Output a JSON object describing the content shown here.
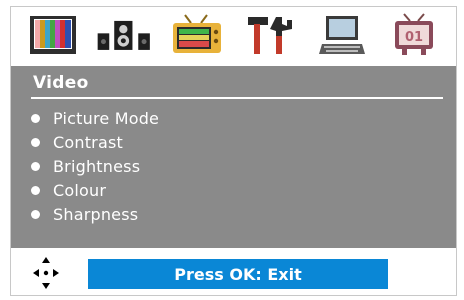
{
  "icons": [
    {
      "name": "picture-icon"
    },
    {
      "name": "audio-speakers-icon"
    },
    {
      "name": "tv-icon"
    },
    {
      "name": "tools-icon"
    },
    {
      "name": "computer-icon"
    },
    {
      "name": "channel-tv-icon",
      "text": "01"
    }
  ],
  "menu": {
    "title": "Video",
    "items": [
      {
        "label": "Picture Mode"
      },
      {
        "label": "Contrast"
      },
      {
        "label": "Brightness"
      },
      {
        "label": "Colour"
      },
      {
        "label": "Sharpness"
      }
    ]
  },
  "footer": {
    "nav_icon": "directional-pad-icon",
    "exit_label": "Press OK: Exit"
  },
  "colors": {
    "panel": "#8a8a8a",
    "exit_bar": "#0a87d6",
    "text": "#ffffff"
  }
}
